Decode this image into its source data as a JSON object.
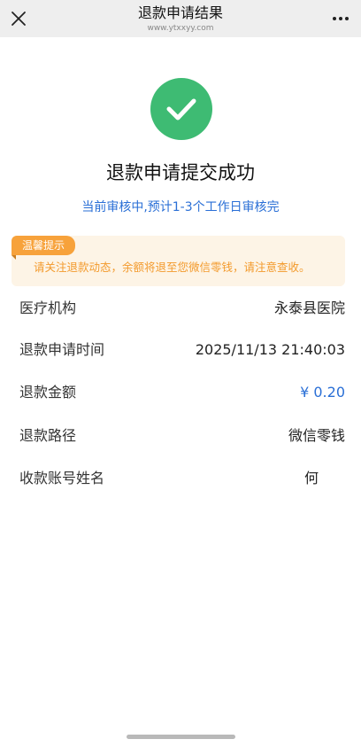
{
  "navbar": {
    "title": "退款申请结果",
    "url": "www.ytxxyy.com"
  },
  "result": {
    "title": "退款申请提交成功",
    "subtitle": "当前审核中,预计1-3个工作日审核完"
  },
  "notice": {
    "tag": "温馨提示",
    "text": "请关注退款动态，余额将退至您微信零钱，请注意查收。"
  },
  "info": [
    {
      "label": "医疗机构",
      "value": "永泰县医院"
    },
    {
      "label": "退款申请时间",
      "value": "2025/11/13 21:40:03"
    },
    {
      "label": "退款金额",
      "value": "¥ 0.20"
    },
    {
      "label": "退款路径",
      "value": "微信零钱"
    },
    {
      "label": "收款账号姓名",
      "value": "何"
    }
  ],
  "colors": {
    "success": "#3ebb73",
    "link_blue": "#2a6fd6",
    "notice_orange": "#f7a23b",
    "notice_bg": "#fdf4e6"
  },
  "icons": {
    "close": "close-icon",
    "more": "more-icon",
    "success": "check-icon"
  }
}
